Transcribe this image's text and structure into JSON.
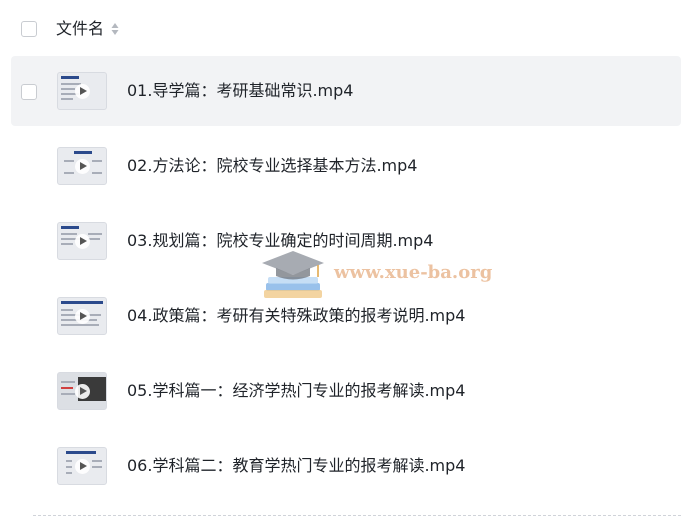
{
  "header": {
    "column_label": "文件名"
  },
  "files": [
    {
      "name": "01.导学篇：考研基础常识.mp4",
      "hovered": true
    },
    {
      "name": "02.方法论：院校专业选择基本方法.mp4",
      "hovered": false
    },
    {
      "name": "03.规划篇：院校专业确定的时间周期.mp4",
      "hovered": false
    },
    {
      "name": "04.政策篇：考研有关特殊政策的报考说明.mp4",
      "hovered": false
    },
    {
      "name": "05.学科篇一：经济学热门专业的报考解读.mp4",
      "hovered": false
    },
    {
      "name": "06.学科篇二：教育学热门专业的报考解读.mp4",
      "hovered": false
    }
  ],
  "watermark": {
    "text": "www.xue-ba.org",
    "icon": "graduation-cap-books-icon"
  },
  "colors": {
    "hover_row": "#f2f3f5",
    "text": "#1f2329",
    "watermark": "#e8b48a"
  }
}
